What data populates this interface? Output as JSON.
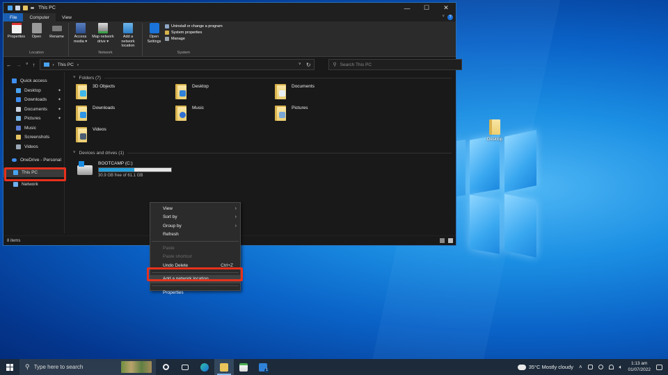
{
  "window": {
    "title": "This PC",
    "controls": {
      "minimize": "—",
      "maximize": "☐",
      "close": "✕"
    }
  },
  "ribbon": {
    "tabs": [
      {
        "label": "File"
      },
      {
        "label": "Computer"
      },
      {
        "label": "View"
      }
    ],
    "help": "?",
    "groups": {
      "location": {
        "name": "Location",
        "buttons": [
          "Properties",
          "Open",
          "Rename"
        ]
      },
      "network": {
        "name": "Network",
        "buttons": [
          "Access media ▾",
          "Map network drive ▾",
          "Add a network location"
        ]
      },
      "system": {
        "name": "System",
        "open_settings": "Open Settings",
        "links": [
          "Uninstall or change a program",
          "System properties",
          "Manage"
        ]
      }
    }
  },
  "address": {
    "path_root": "This PC",
    "separator": "›",
    "search_placeholder": "Search This PC"
  },
  "sidebar": {
    "items": [
      {
        "label": "Quick access",
        "color": "#3f8ef0",
        "pinned": false
      },
      {
        "label": "Desktop",
        "color": "#4aa3f0",
        "pinned": true
      },
      {
        "label": "Downloads",
        "color": "#3f8ef0",
        "pinned": true
      },
      {
        "label": "Documents",
        "color": "#c9d3e0",
        "pinned": true
      },
      {
        "label": "Pictures",
        "color": "#7bb8e8",
        "pinned": true
      },
      {
        "label": "Music",
        "color": "#5c7fd6",
        "pinned": false
      },
      {
        "label": "Screenshots",
        "color": "#e6c463",
        "pinned": false
      },
      {
        "label": "Videos",
        "color": "#9aa7b6",
        "pinned": false
      },
      {
        "label": "OneDrive - Personal",
        "color": "#3f8ef0",
        "pinned": false
      },
      {
        "label": "This PC",
        "color": "#4aa3f0",
        "pinned": false
      },
      {
        "label": "Network",
        "color": "#6fb0ef",
        "pinned": false
      }
    ]
  },
  "content": {
    "folders_header": "Folders (7)",
    "folders": [
      {
        "label": "3D Objects",
        "badge": "#3fb7e8"
      },
      {
        "label": "Desktop",
        "badge": "#2f82d8"
      },
      {
        "label": "Documents",
        "badge": "#e8eef5"
      },
      {
        "label": "Downloads",
        "badge": "#2f95e6"
      },
      {
        "label": "Music",
        "badge": "#2f6fd1"
      },
      {
        "label": "Pictures",
        "badge": "#7aa6d6"
      },
      {
        "label": "Videos",
        "badge": "#4a5d74"
      }
    ],
    "drives_header": "Devices and drives (1)",
    "drive": {
      "name": "BOOTCAMP (C:)",
      "free_text": "30.9 GB free of 61.1 GB",
      "used_fraction": 0.494
    }
  },
  "status": {
    "items_count": "8 items"
  },
  "context_menu": {
    "items": [
      {
        "label": "View",
        "arrow": "›",
        "disabled": false
      },
      {
        "label": "Sort by",
        "arrow": "›",
        "disabled": false
      },
      {
        "label": "Group by",
        "arrow": "›",
        "disabled": false
      },
      {
        "label": "Refresh",
        "disabled": false
      },
      {
        "label": "Paste",
        "disabled": true
      },
      {
        "label": "Paste shortcut",
        "disabled": true
      },
      {
        "label": "Undo Delete",
        "shortcut": "Ctrl+Z",
        "disabled": false
      },
      {
        "label": "Add a network location",
        "disabled": false
      },
      {
        "label": "Properties",
        "disabled": false
      }
    ]
  },
  "desktop": {
    "icon_label": "Desktop"
  },
  "taskbar": {
    "search_placeholder": "Type here to search",
    "weather": "35°C  Mostly cloudy",
    "time": "1:13 am",
    "date": "01/07/2022",
    "mail_badge": "1"
  },
  "colors": {
    "accent": "#1a5fb4",
    "highlight_box": "#e8311c",
    "drive_bar": "#26a0da"
  }
}
